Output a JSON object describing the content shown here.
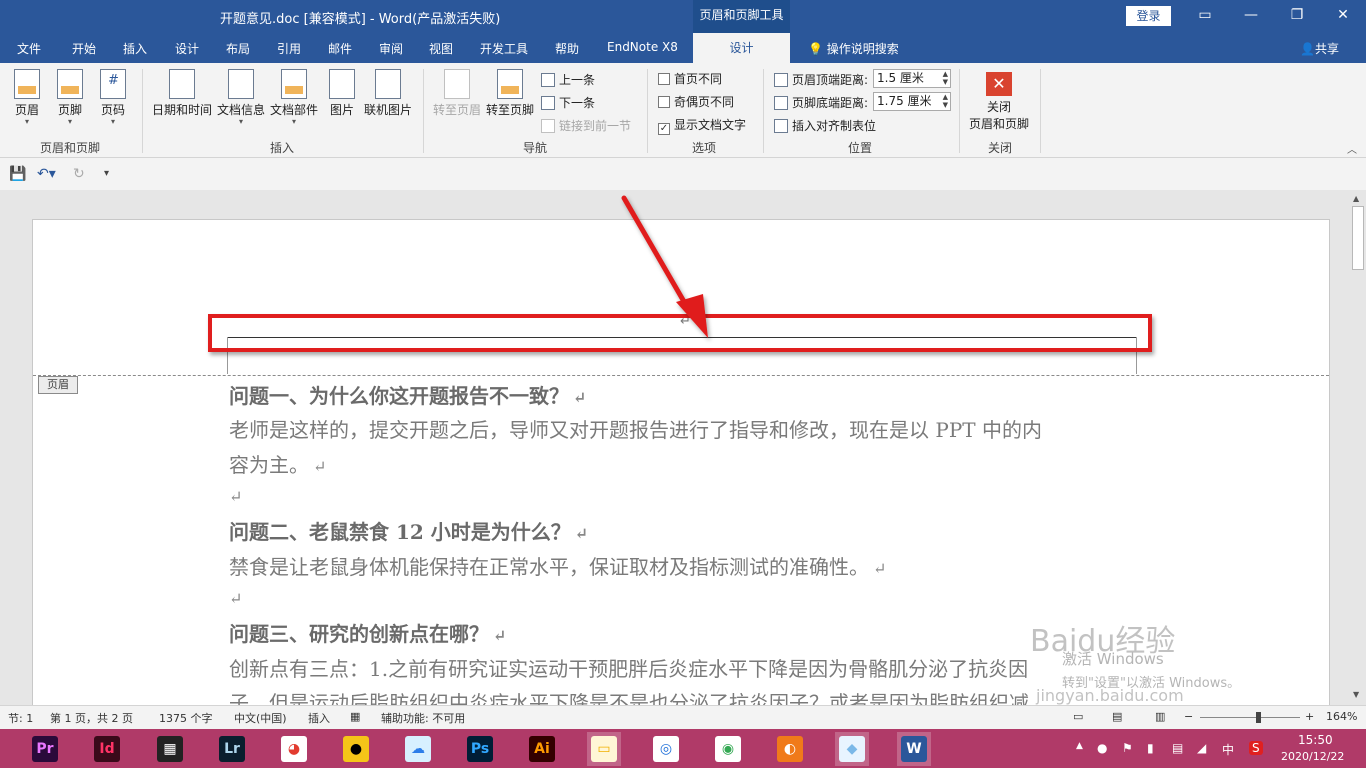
{
  "titlebar": {
    "title": "开题意见.doc [兼容模式] - Word(产品激活失败)",
    "context_tab_title": "页眉和页脚工具",
    "login": "登录",
    "ribbon_display_icon": "ribbon-display-icon",
    "minimize": "—",
    "restore": "❐",
    "close": "✕"
  },
  "tabs": [
    "文件",
    "开始",
    "插入",
    "设计",
    "布局",
    "引用",
    "邮件",
    "审阅",
    "视图",
    "开发工具",
    "帮助",
    "EndNote X8"
  ],
  "active_tab": "设计",
  "tell_me": "操作说明搜索",
  "share": "共享",
  "ribbon": {
    "group_header_footer": {
      "label": "页眉和页脚",
      "header": "页眉",
      "footer": "页脚",
      "page_number": "页码"
    },
    "group_insert": {
      "label": "插入",
      "datetime": "日期和时间",
      "docinfo": "文档信息",
      "quickparts": "文档部件",
      "picture": "图片",
      "online_picture": "联机图片"
    },
    "group_nav": {
      "label": "导航",
      "goto_header": "转至页眉",
      "goto_footer": "转至页脚",
      "previous": "上一条",
      "next": "下一条",
      "link_previous": "链接到前一节"
    },
    "group_options": {
      "label": "选项",
      "diff_first": "首页不同",
      "diff_odd_even": "奇偶页不同",
      "show_doc_text": "显示文档文字",
      "show_doc_text_checked": "✓"
    },
    "group_position": {
      "label": "位置",
      "header_top": "页眉顶端距离:",
      "header_top_value": "1.5 厘米",
      "footer_bottom": "页脚底端距离:",
      "footer_bottom_value": "1.75 厘米",
      "insert_align_tab": "插入对齐制表位"
    },
    "group_close": {
      "label": "关闭",
      "close_hf_1": "关闭",
      "close_hf_2": "页眉和页脚"
    }
  },
  "document": {
    "header_tag": "页眉",
    "paragraph_mark": "↵",
    "paragraphs": [
      {
        "text": "问题一、为什么你这开题报告不一致？",
        "bold": true
      },
      {
        "text": "老师是这样的，提交开题之后，导师又对开题报告进行了指导和修改，现在是以 PPT 中的内",
        "bold": false
      },
      {
        "text": "容为主。",
        "bold": false
      },
      {
        "text": "",
        "bold": false
      },
      {
        "text": "问题二、老鼠禁食 12 小时是为什么？",
        "bold": true
      },
      {
        "text": "禁食是让老鼠身体机能保持在正常水平，保证取材及指标测试的准确性。",
        "bold": false
      },
      {
        "text": "",
        "bold": false
      },
      {
        "text": "问题三、研究的创新点在哪？",
        "bold": true
      },
      {
        "text": "创新点有三点：1.之前有研究证实运动干预肥胖后炎症水平下降是因为骨骼肌分泌了抗炎因",
        "bold": false
      },
      {
        "text": "子，但是运动后脂肪组织中炎症水平下降是不是也分泌了抗炎因子？或者是因为脂肪组织减",
        "bold": false
      }
    ]
  },
  "statusbar": {
    "section": "节: 1",
    "page": "第 1 页，共 2 页",
    "words": "1375 个字",
    "language": "中文(中国)",
    "mode": "插入",
    "accessibility": "辅助功能: 不可用",
    "zoom": "164%",
    "zoom_minus": "−",
    "zoom_plus": "+"
  },
  "watermark": {
    "text": "Baidu经验",
    "url": "jingyan.baidu.com",
    "activate_1": "激活 Windows",
    "activate_2": "转到\"设置\"以激活 Windows。"
  },
  "taskbar": {
    "apps": [
      {
        "label": "Pr",
        "name": "premiere-icon",
        "color": "#ea77ff",
        "bg": "#2a0a3a"
      },
      {
        "label": "Id",
        "name": "indesign-icon",
        "color": "#ff3366",
        "bg": "#3a0a1a"
      },
      {
        "label": "▦",
        "name": "video-editor-icon",
        "color": "#ffffff",
        "bg": "#222222"
      },
      {
        "label": "Lr",
        "name": "lightroom-icon",
        "color": "#add5ec",
        "bg": "#0a1e2e"
      },
      {
        "label": "◕",
        "name": "app-pie-icon",
        "color": "#e23b2f",
        "bg": "#ffffff"
      },
      {
        "label": "●",
        "name": "qq-icon",
        "color": "#000000",
        "bg": "#f5c518"
      },
      {
        "label": "☁",
        "name": "cloud-app-icon",
        "color": "#2b7de9",
        "bg": "#d7f0ff"
      },
      {
        "label": "Ps",
        "name": "photoshop-icon",
        "color": "#31a8ff",
        "bg": "#001e36"
      },
      {
        "label": "Ai",
        "name": "illustrator-icon",
        "color": "#ff9a00",
        "bg": "#330000"
      },
      {
        "label": "▭",
        "name": "file-explorer-icon",
        "color": "#f0b000",
        "bg": "#fff6d6"
      },
      {
        "label": "◎",
        "name": "browser-icon",
        "color": "#1e6fd9",
        "bg": "#ffffff"
      },
      {
        "label": "◉",
        "name": "chrome-icon",
        "color": "#34a853",
        "bg": "#ffffff"
      },
      {
        "label": "◐",
        "name": "player-icon",
        "color": "#ffffff",
        "bg": "#f07a1a"
      },
      {
        "label": "◆",
        "name": "notes-app-icon",
        "color": "#7ab8e8",
        "bg": "#e8f4ff"
      },
      {
        "label": "W",
        "name": "word-icon",
        "color": "#ffffff",
        "bg": "#2b579a"
      }
    ],
    "tray_ime": "中",
    "time": "15:50",
    "date": "2020/12/22"
  }
}
